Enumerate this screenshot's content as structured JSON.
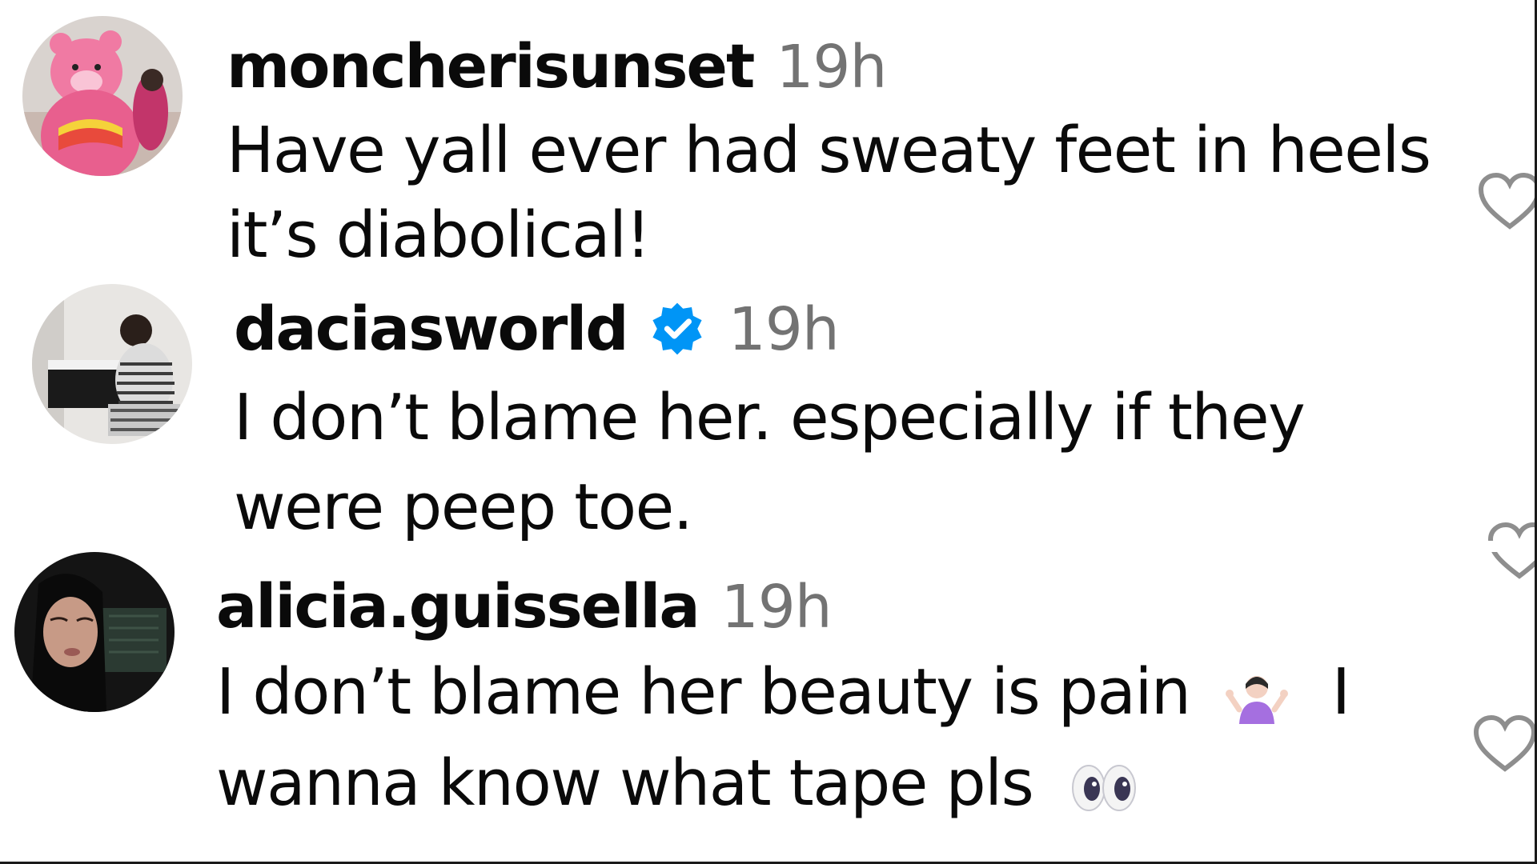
{
  "comments": [
    {
      "username": "moncherisunset",
      "verified": false,
      "timestamp": "19h",
      "lines": [
        "Have yall ever had sweaty feet in heels",
        "it’s diabolical!"
      ],
      "avatar_icon": "pink-bear-avatar"
    },
    {
      "username": "daciasworld",
      "verified": true,
      "timestamp": "19h",
      "lines": [
        "I don’t blame her. especially if they",
        "were peep toe."
      ],
      "avatar_icon": "piano-player-avatar"
    },
    {
      "username": "alicia.guissella",
      "verified": false,
      "timestamp": "19h",
      "lines": [
        "I don’t blame her beauty is pain",
        "I",
        "wanna know what tape pls"
      ],
      "avatar_icon": "selfie-avatar",
      "emojis": [
        "shrugging-woman-emoji",
        "eyes-emoji"
      ]
    }
  ],
  "colors": {
    "text": "#0a0a0a",
    "secondary": "#737373",
    "verified_blue": "#0095f6",
    "heart_stroke": "#8e8e8e"
  }
}
